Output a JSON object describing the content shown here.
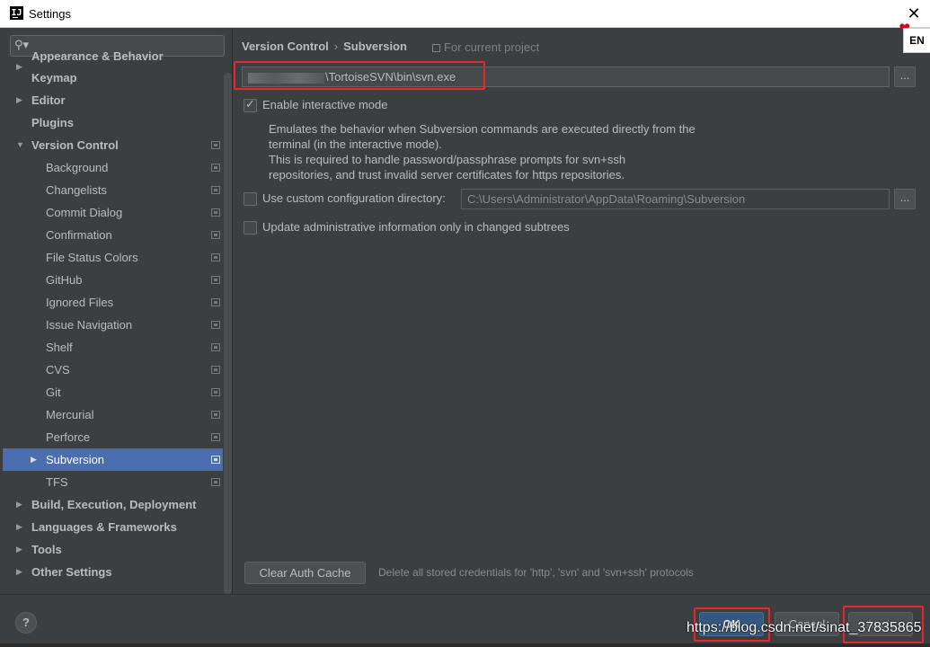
{
  "window": {
    "title": "Settings",
    "app_icon": "IJ",
    "close_symbol": "✕"
  },
  "ime": {
    "label": "EN"
  },
  "search": {
    "icon": "search-icon",
    "placeholder": ""
  },
  "sidebar": {
    "items": [
      {
        "label": "Appearance & Behavior",
        "level": 0,
        "arrow": "▶",
        "project": false,
        "clipped": true
      },
      {
        "label": "Keymap",
        "level": 0,
        "arrow": "",
        "project": false
      },
      {
        "label": "Editor",
        "level": 0,
        "arrow": "▶",
        "project": false
      },
      {
        "label": "Plugins",
        "level": 0,
        "arrow": "",
        "project": false
      },
      {
        "label": "Version Control",
        "level": 0,
        "arrow": "▼",
        "project": true
      },
      {
        "label": "Background",
        "level": 1,
        "arrow": "",
        "project": true
      },
      {
        "label": "Changelists",
        "level": 1,
        "arrow": "",
        "project": true
      },
      {
        "label": "Commit Dialog",
        "level": 1,
        "arrow": "",
        "project": true
      },
      {
        "label": "Confirmation",
        "level": 1,
        "arrow": "",
        "project": true
      },
      {
        "label": "File Status Colors",
        "level": 1,
        "arrow": "",
        "project": true
      },
      {
        "label": "GitHub",
        "level": 1,
        "arrow": "",
        "project": true
      },
      {
        "label": "Ignored Files",
        "level": 1,
        "arrow": "",
        "project": true
      },
      {
        "label": "Issue Navigation",
        "level": 1,
        "arrow": "",
        "project": true
      },
      {
        "label": "Shelf",
        "level": 1,
        "arrow": "",
        "project": true
      },
      {
        "label": "CVS",
        "level": 1,
        "arrow": "",
        "project": true
      },
      {
        "label": "Git",
        "level": 1,
        "arrow": "",
        "project": true
      },
      {
        "label": "Mercurial",
        "level": 1,
        "arrow": "",
        "project": true
      },
      {
        "label": "Perforce",
        "level": 1,
        "arrow": "",
        "project": true
      },
      {
        "label": "Subversion",
        "level": 1,
        "arrow": "▶",
        "project": true,
        "selected": true
      },
      {
        "label": "TFS",
        "level": 1,
        "arrow": "",
        "project": true
      },
      {
        "label": "Build, Execution, Deployment",
        "level": 0,
        "arrow": "▶",
        "project": false
      },
      {
        "label": "Languages & Frameworks",
        "level": 0,
        "arrow": "▶",
        "project": false
      },
      {
        "label": "Tools",
        "level": 0,
        "arrow": "▶",
        "project": false
      },
      {
        "label": "Other Settings",
        "level": 0,
        "arrow": "▶",
        "project": false
      }
    ]
  },
  "breadcrumb": {
    "parent": "Version Control",
    "separator": "›",
    "current": "Subversion",
    "scope": "For current project"
  },
  "svn_path": {
    "value": "\\TortoiseSVN\\bin\\svn.exe",
    "browse": "..."
  },
  "interactive_mode": {
    "label": "Enable interactive mode",
    "checked": true,
    "description": [
      "Emulates the behavior when Subversion commands are executed directly from the",
      "terminal (in the interactive mode).",
      "This is required to handle password/passphrase prompts for svn+ssh",
      "repositories, and trust invalid server certificates for https repositories."
    ]
  },
  "custom_config": {
    "label": "Use custom configuration directory:",
    "checked": false,
    "value": "C:\\Users\\Administrator\\AppData\\Roaming\\Subversion",
    "browse": "..."
  },
  "update_admin": {
    "label": "Update administrative information only in changed subtrees",
    "checked": false
  },
  "auth_cache": {
    "button": "Clear Auth Cache",
    "hint": "Delete all stored credentials for 'http', 'svn' and 'svn+ssh' protocols"
  },
  "footer": {
    "help": "?",
    "ok": "OK",
    "cancel": "Cancel",
    "apply": "Apply",
    "watermark": "https://blog.csdn.net/sinat_37835865"
  },
  "colors": {
    "background": "#3c3f41",
    "selection": "#4b6eaf",
    "ok_button": "#365880",
    "highlight_box": "#e8262c"
  }
}
